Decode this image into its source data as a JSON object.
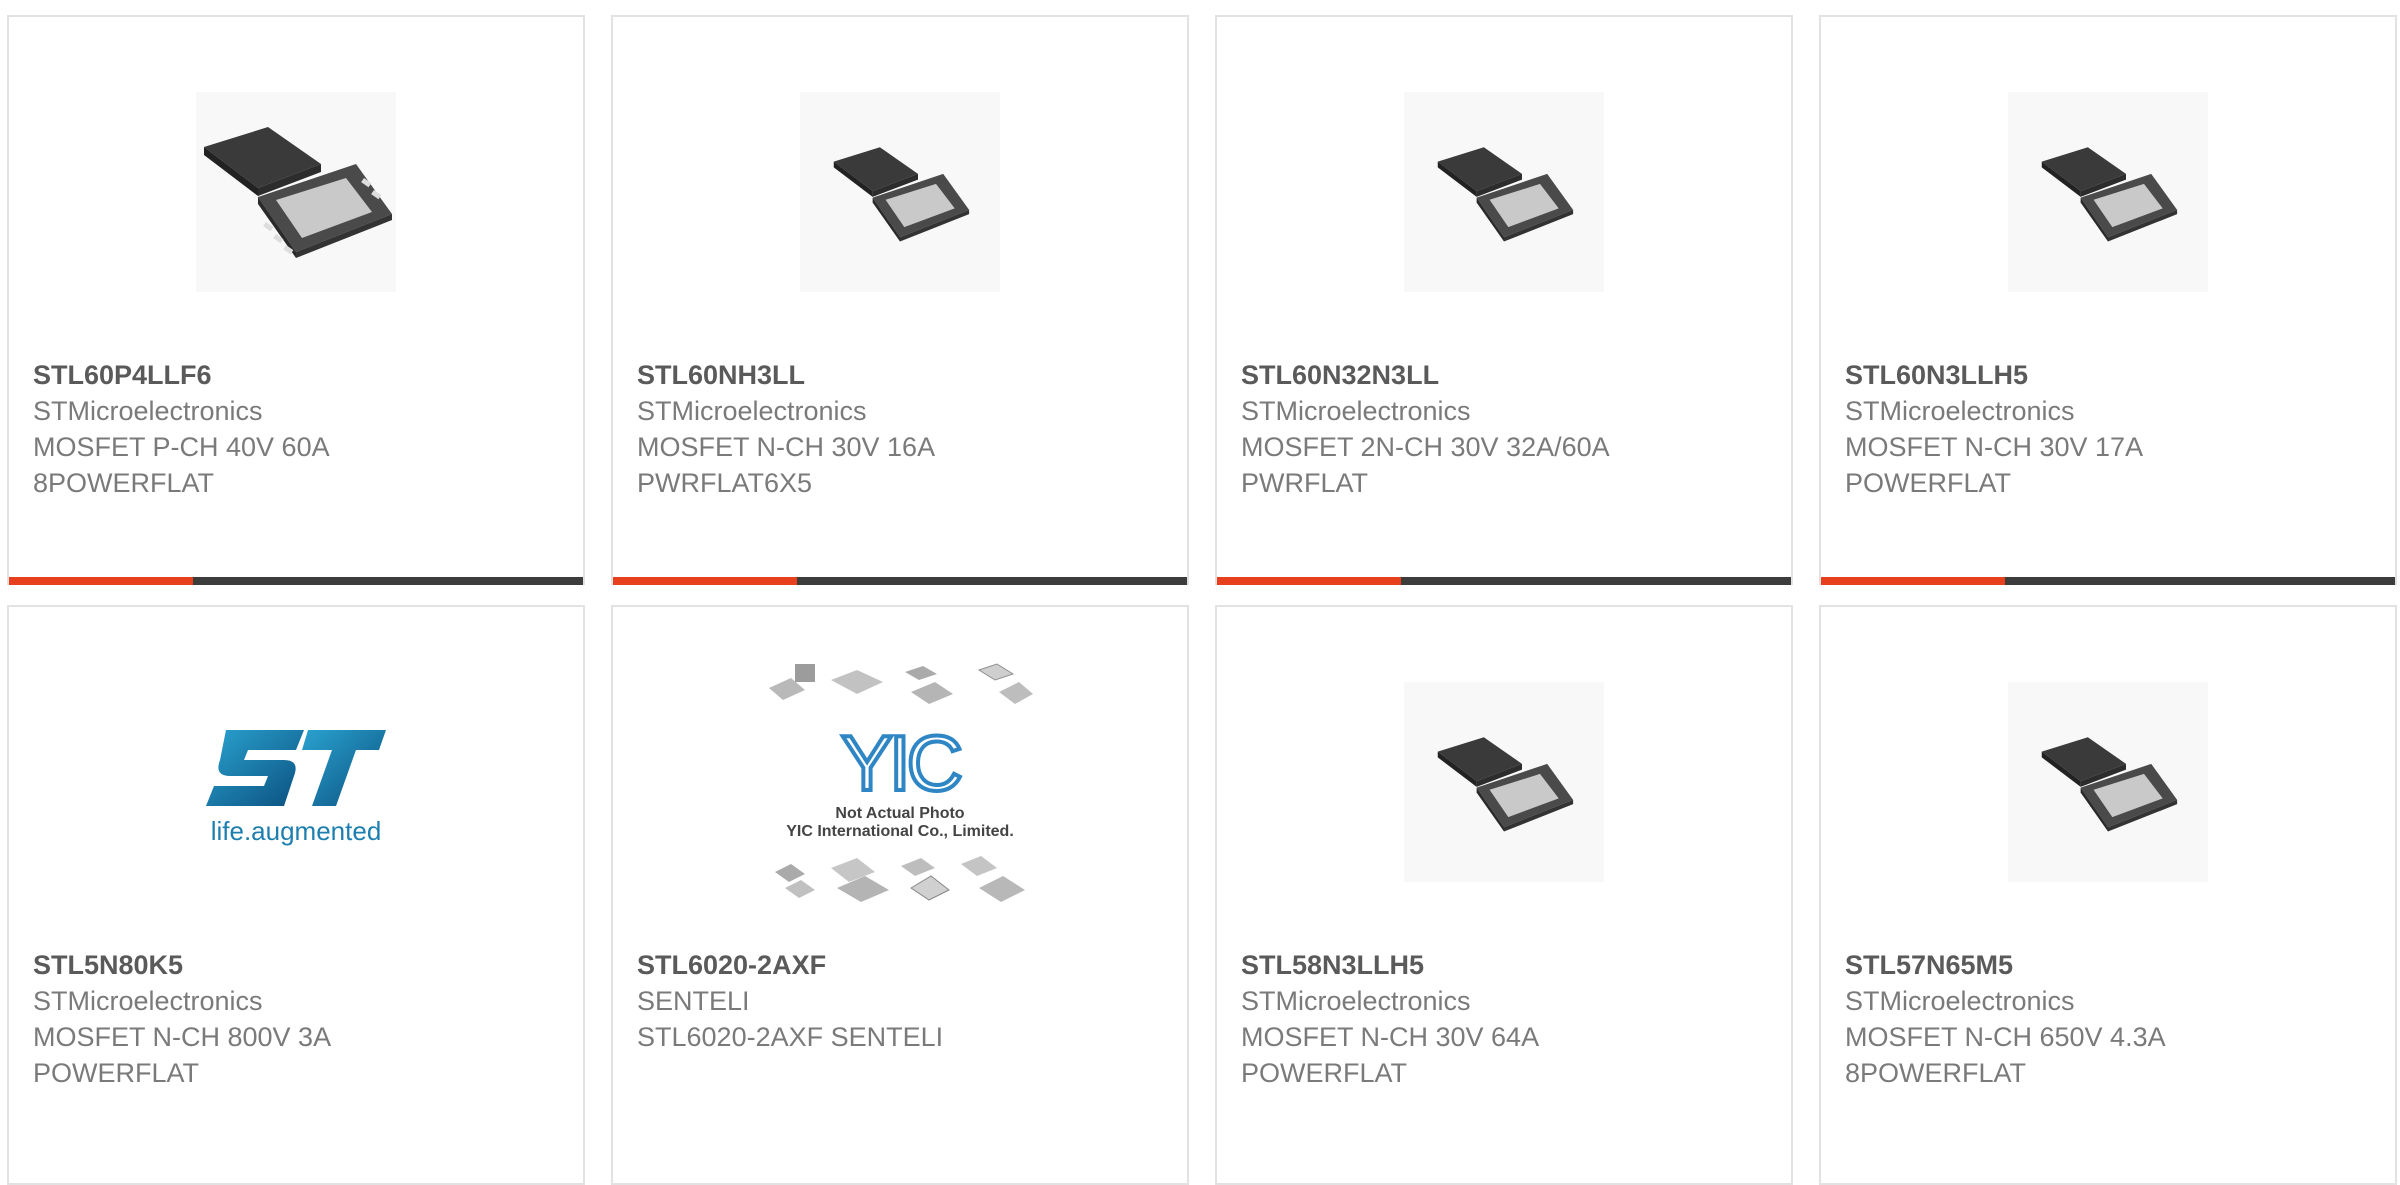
{
  "colors": {
    "accent": "#e8401c",
    "bar": "#3c3c3c",
    "border": "#e2e2e2"
  },
  "products": [
    {
      "part": "STL60P4LLF6",
      "mfr": "STMicroelectronics",
      "desc": "MOSFET P-CH 40V 60A\n8POWERFLAT",
      "image": "powerflat-chip"
    },
    {
      "part": "STL60NH3LL",
      "mfr": "STMicroelectronics",
      "desc": "MOSFET N-CH 30V 16A\nPWRFLAT6X5",
      "image": "powerflat-chip"
    },
    {
      "part": "STL60N32N3LL",
      "mfr": "STMicroelectronics",
      "desc": "MOSFET 2N-CH 30V 32A/60A\nPWRFLAT",
      "image": "powerflat-chip"
    },
    {
      "part": "STL60N3LLH5",
      "mfr": "STMicroelectronics",
      "desc": "MOSFET N-CH 30V 17A\nPOWERFLAT",
      "image": "powerflat-chip"
    },
    {
      "part": "STL5N80K5",
      "mfr": "STMicroelectronics",
      "desc": "MOSFET N-CH 800V 3A\nPOWERFLAT",
      "image": "st-logo",
      "logo_tagline": "life.augmented"
    },
    {
      "part": "STL6020-2AXF",
      "mfr": "SENTELI",
      "desc": "STL6020-2AXF SENTELI",
      "image": "yic-placeholder",
      "logo_text": "YIC",
      "notice_line1": "Not Actual Photo",
      "notice_line2": "YIC International Co., Limited."
    },
    {
      "part": "STL58N3LLH5",
      "mfr": "STMicroelectronics",
      "desc": "MOSFET N-CH 30V 64A\nPOWERFLAT",
      "image": "powerflat-chip"
    },
    {
      "part": "STL57N65M5",
      "mfr": "STMicroelectronics",
      "desc": "MOSFET N-CH 650V 4.3A\n8POWERFLAT",
      "image": "powerflat-chip"
    }
  ]
}
